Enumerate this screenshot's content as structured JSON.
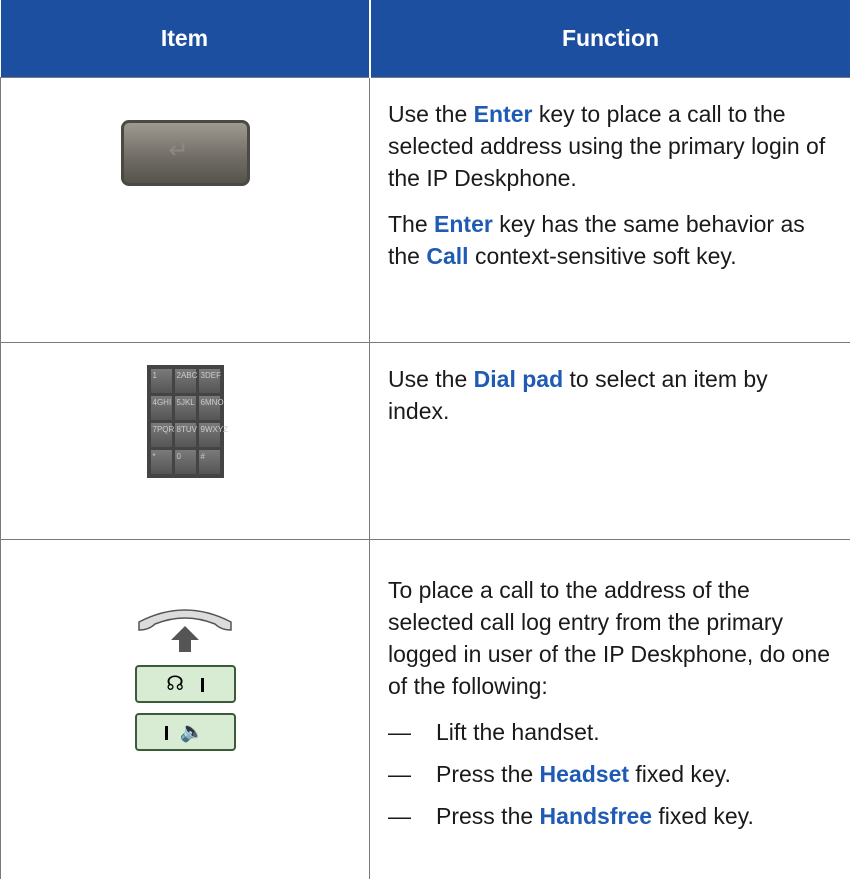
{
  "header": {
    "item": "Item",
    "function": "Function"
  },
  "rows": [
    {
      "func": [
        [
          "Use the ",
          "Enter",
          " key to place a call to the selected address using the primary login of the IP Deskphone."
        ],
        [
          "The ",
          "Enter",
          " key has the same behavior as the ",
          "Call",
          " context-sensitive soft key."
        ]
      ],
      "icon": "enter-key-icon"
    },
    {
      "func": [
        [
          "Use the ",
          "Dial pad",
          " to select an item by index."
        ]
      ],
      "icon": "dial-pad-icon",
      "keys": [
        "1",
        "2ABC",
        "3DEF",
        "4GHI",
        "5JKL",
        "6MNO",
        "7PQRS",
        "8TUV",
        "9WXYZ",
        "*",
        "0",
        "#"
      ]
    },
    {
      "intro": "To place a call to the address of the selected call log entry from the primary logged in user of the IP Deskphone, do one of the following:",
      "bullets": [
        {
          "dash": "—",
          "pre": "Lift the handset.",
          "kw": "",
          "post": ""
        },
        {
          "dash": "—",
          "pre": "Press the ",
          "kw": "Headset",
          "post": " fixed key."
        },
        {
          "dash": "—",
          "pre": "Press the ",
          "kw": "Handsfree",
          "post": " fixed key."
        }
      ],
      "icons": [
        "handset-icon",
        "headset-key-icon",
        "handsfree-key-icon"
      ]
    }
  ],
  "colors": {
    "header": "#1d4fa0",
    "keyword": "#1f5bb5",
    "key_green": "#d7ecd2"
  }
}
